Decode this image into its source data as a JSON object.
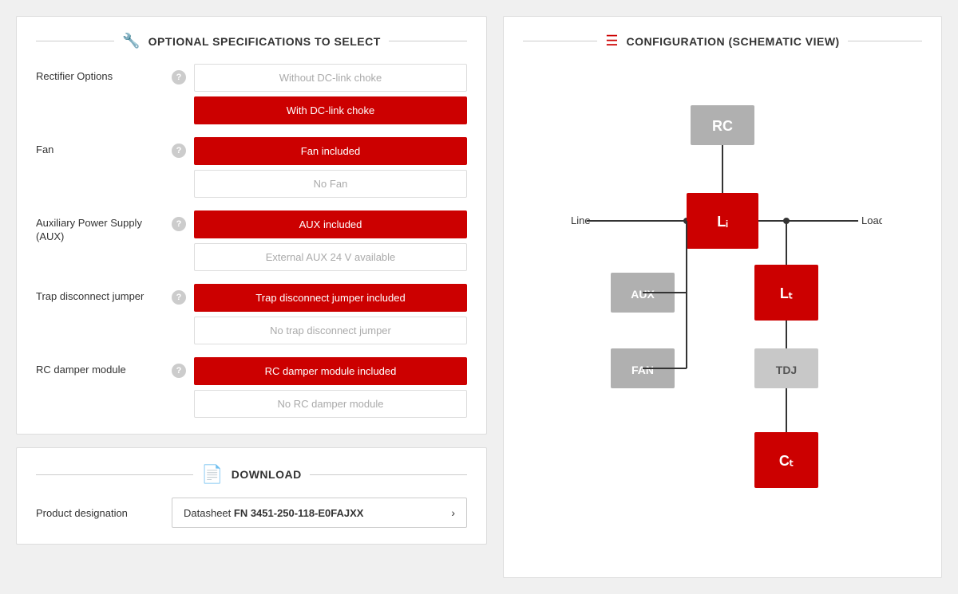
{
  "leftPanel": {
    "title": "OPTIONAL SPECIFICATIONS TO SELECT",
    "icon": "🔧",
    "rows": [
      {
        "label": "Rectifier Options",
        "options": [
          {
            "text": "Without DC-link choke",
            "active": false
          },
          {
            "text": "With DC-link choke",
            "active": true
          }
        ]
      },
      {
        "label": "Fan",
        "options": [
          {
            "text": "Fan included",
            "active": true
          },
          {
            "text": "No Fan",
            "active": false
          }
        ]
      },
      {
        "label": "Auxiliary Power Supply (AUX)",
        "options": [
          {
            "text": "AUX included",
            "active": true
          },
          {
            "text": "External AUX 24 V available",
            "active": false
          }
        ]
      },
      {
        "label": "Trap disconnect jumper",
        "options": [
          {
            "text": "Trap disconnect jumper included",
            "active": true
          },
          {
            "text": "No trap disconnect jumper",
            "active": false
          }
        ]
      },
      {
        "label": "RC damper module",
        "options": [
          {
            "text": "RC damper module included",
            "active": true
          },
          {
            "text": "No RC damper module",
            "active": false
          }
        ]
      }
    ]
  },
  "downloadPanel": {
    "title": "DOWNLOAD",
    "productLabel": "Product designation",
    "datastesheetText": "Datasheet",
    "datastesheetValue": "FN 3451-250-118-E0FAJXX"
  },
  "rightPanel": {
    "title": "CONFIGURATION (SCHEMATIC VIEW)",
    "lineLabel": "Line",
    "loadLabel": "Load",
    "blocks": {
      "RC": "RC",
      "Li": "Lᵢ",
      "Lt": "Lₜ",
      "AUX": "AUX",
      "FAN": "FAN",
      "TDJ": "TDJ",
      "Ct": "Cₜ"
    }
  }
}
